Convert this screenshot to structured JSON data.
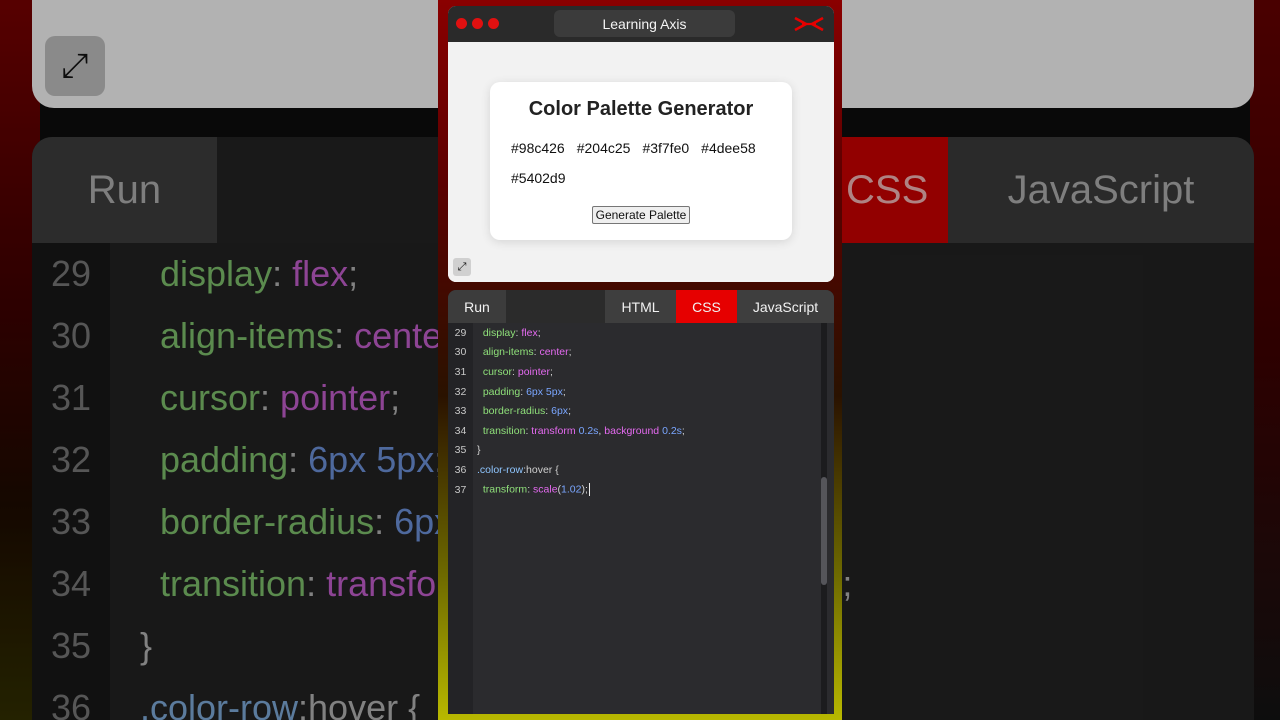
{
  "window": {
    "title": "Learning Axis",
    "logo": "learning-axis-logo-icon"
  },
  "preview": {
    "heading": "Color Palette Generator",
    "colors": [
      "#98c426",
      "#204c25",
      "#3f7fe0",
      "#4dee58",
      "#5402d9"
    ],
    "generate_label": "Generate Palette",
    "expand_icon": "expand-arrows-icon"
  },
  "editor": {
    "run_label": "Run",
    "tabs": [
      "HTML",
      "CSS",
      "JavaScript"
    ],
    "active_tab": "CSS",
    "lines": [
      {
        "num": "29",
        "tokens": [
          [
            "p",
            "  display"
          ],
          [
            "pun",
            ": "
          ],
          [
            "v",
            "flex"
          ],
          [
            "pun",
            ";"
          ]
        ]
      },
      {
        "num": "30",
        "tokens": [
          [
            "p",
            "  align-items"
          ],
          [
            "pun",
            ": "
          ],
          [
            "v",
            "center"
          ],
          [
            "pun",
            ";"
          ]
        ]
      },
      {
        "num": "31",
        "tokens": [
          [
            "p",
            "  cursor"
          ],
          [
            "pun",
            ": "
          ],
          [
            "v",
            "pointer"
          ],
          [
            "pun",
            ";"
          ]
        ]
      },
      {
        "num": "32",
        "tokens": [
          [
            "p",
            "  padding"
          ],
          [
            "pun",
            ": "
          ],
          [
            "num",
            "6px 5px"
          ],
          [
            "pun",
            ";"
          ]
        ]
      },
      {
        "num": "33",
        "tokens": [
          [
            "p",
            "  border-radius"
          ],
          [
            "pun",
            ": "
          ],
          [
            "num",
            "6px"
          ],
          [
            "pun",
            ";"
          ]
        ]
      },
      {
        "num": "34",
        "tokens": [
          [
            "p",
            "  transition"
          ],
          [
            "pun",
            ": "
          ],
          [
            "v",
            "transform"
          ],
          [
            "pun",
            " "
          ],
          [
            "num",
            "0.2s"
          ],
          [
            "pun",
            ", "
          ],
          [
            "v",
            "background"
          ],
          [
            "pun",
            " "
          ],
          [
            "num",
            "0.2s"
          ],
          [
            "pun",
            ";"
          ]
        ]
      },
      {
        "num": "35",
        "tokens": [
          [
            "pun",
            "}"
          ]
        ]
      },
      {
        "num": "36",
        "tokens": [
          [
            "sel",
            ".color-row"
          ],
          [
            "pun",
            ":hover {"
          ]
        ]
      },
      {
        "num": "37",
        "tokens": [
          [
            "p",
            "  transform"
          ],
          [
            "pun",
            ": "
          ],
          [
            "v",
            "scale"
          ],
          [
            "pun",
            "("
          ],
          [
            "num",
            "1.02"
          ],
          [
            "pun",
            ");"
          ]
        ]
      }
    ]
  },
  "colors": {
    "accent_red": "#e60000",
    "dot_red": "#e01010",
    "editor_bg": "#2b2b2e"
  }
}
